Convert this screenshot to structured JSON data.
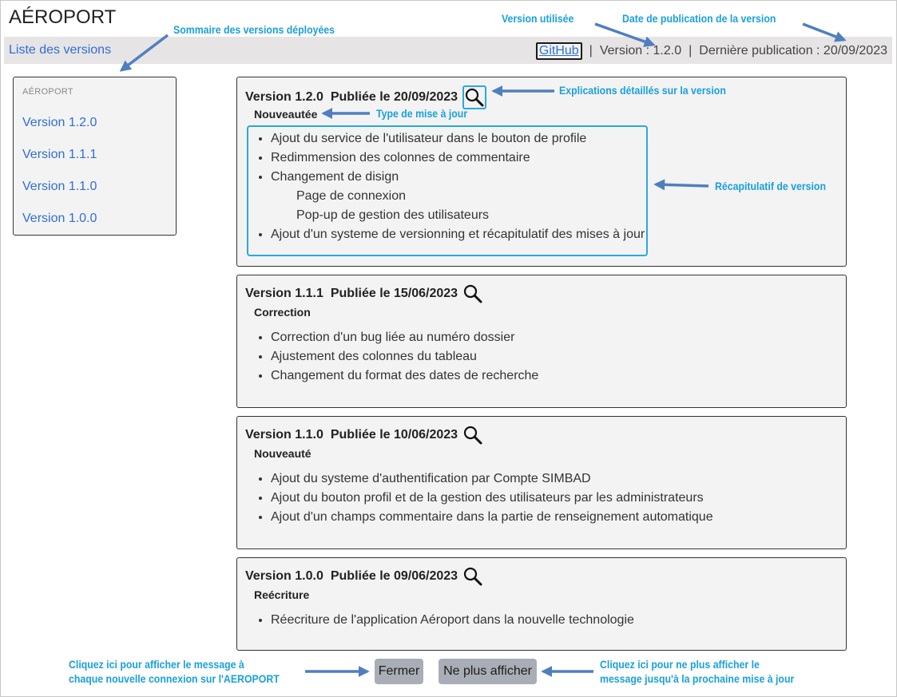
{
  "app": {
    "title": "AÉROPORT"
  },
  "topbar": {
    "versions_link": "Liste des versions",
    "github_label": "GitHub",
    "separator": "|",
    "version_text": "Version : 1.2.0",
    "publication_text": "Dernière publication : 20/09/2023"
  },
  "sidebar": {
    "heading": "AÉROPORT",
    "items": [
      "Version 1.2.0",
      "Version 1.1.1",
      "Version 1.1.0",
      "Version 1.0.0"
    ]
  },
  "versions": [
    {
      "version": "Version 1.2.0",
      "published": "Publiée le 20/09/2023",
      "type": "Nouveautée",
      "items": [
        "Ajout du service de l'utilisateur dans le bouton de profile",
        "Redimmension des colonnes de commentaire",
        "Changement de disign",
        "Page de connexion",
        "Pop-up de gestion des utilisateurs",
        "Ajout d'un systeme de versionning et récapitulatif des mises à jour"
      ]
    },
    {
      "version": "Version 1.1.1",
      "published": "Publiée le 15/06/2023",
      "type": "Correction",
      "items": [
        "Correction d'un bug liée au numéro dossier",
        "Ajustement des colonnes du tableau",
        "Changement du format des dates de recherche"
      ]
    },
    {
      "version": "Version 1.1.0",
      "published": "Publiée le 10/06/2023",
      "type": "Nouveauté",
      "items": [
        "Ajout du systeme d'authentification par Compte SIMBAD",
        "Ajout du bouton profil et de la gestion des utilisateurs par les administrateurs",
        "Ajout d'un champs commentaire dans la partie de renseignement automatique"
      ]
    },
    {
      "version": "Version 1.0.0",
      "published": "Publiée le 09/06/2023",
      "type": "Reécriture",
      "items": [
        "Réecriture de l'application Aéroport dans la nouvelle technologie"
      ]
    }
  ],
  "buttons": {
    "close": "Fermer",
    "dont_show": "Ne plus afficher"
  },
  "annotations": {
    "summary": "Sommaire des versions déployées",
    "version_used": "Version utilisée",
    "publication_date": "Date de publication de la version",
    "details": "Explications détaillés sur la version",
    "update_type": "Type de mise à jour",
    "recap": "Récapitulatif de version",
    "close_line1": "Cliquez ici pour afficher le message à",
    "close_line2": "chaque nouvelle connexion sur l'AEROPORT",
    "dont_show_line1": "Cliquez ici pour ne plus afficher le",
    "dont_show_line2": "message jusqu'à la prochaine mise à jour"
  },
  "icons": {
    "details": "magnifier-icon"
  },
  "colors": {
    "link": "#2f6fd6",
    "annotation": "#1aa0dc",
    "arrow": "#4f7fbf",
    "button": "#a9adb5"
  }
}
